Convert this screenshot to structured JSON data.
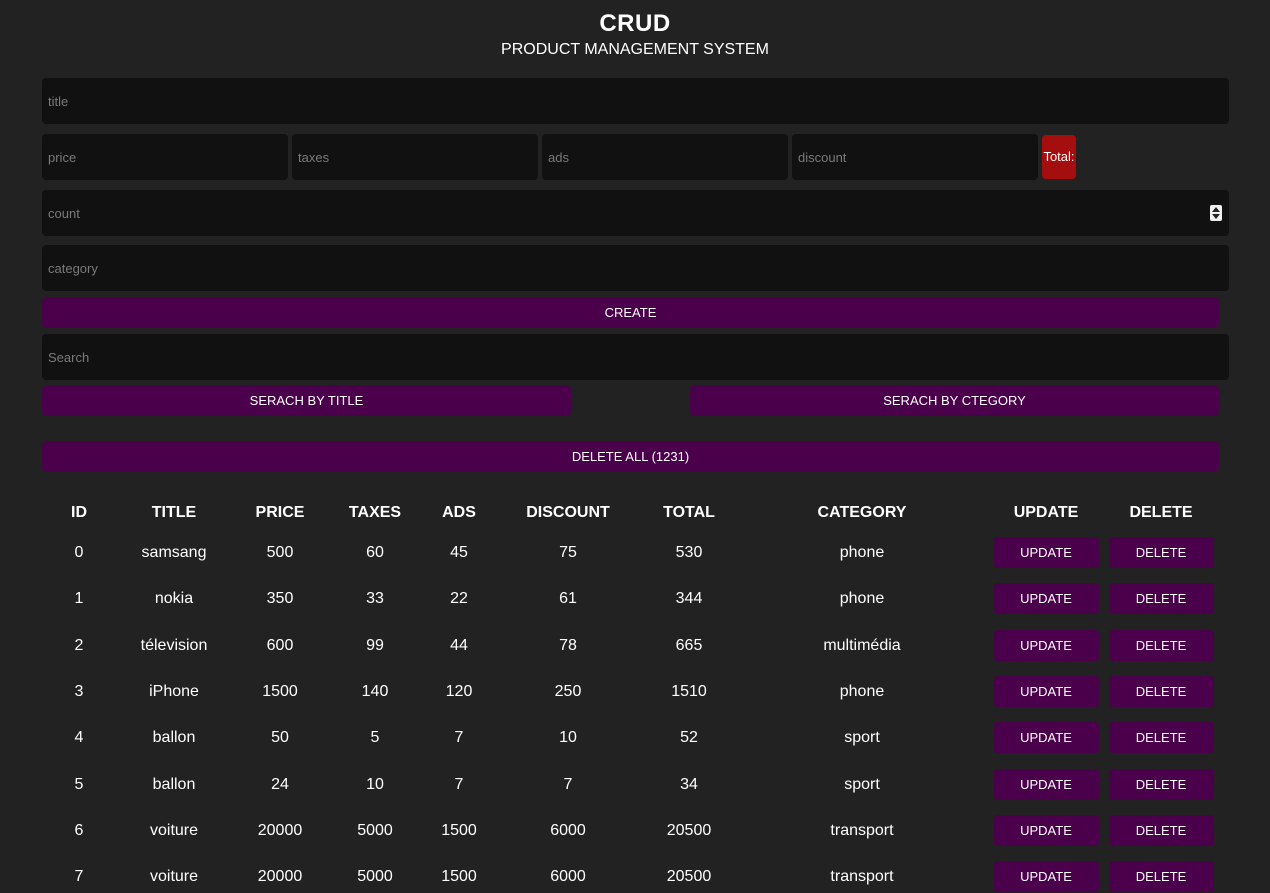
{
  "header": {
    "title": "CRUD",
    "subtitle": "PRODUCT MANAGEMENT SYSTEM"
  },
  "form": {
    "title_placeholder": "title",
    "price_placeholder": "price",
    "taxes_placeholder": "taxes",
    "ads_placeholder": "ads",
    "discount_placeholder": "discount",
    "total_label": "Total:",
    "count_placeholder": "count",
    "category_placeholder": "category",
    "create_label": "CREATE"
  },
  "search": {
    "placeholder": "Search",
    "by_title_label": "SERACH BY TITLE",
    "by_category_label": "SERACH BY CTEGORY"
  },
  "delete_all_label": "DELETE ALL (1231)",
  "table": {
    "headers": [
      "ID",
      "TITLE",
      "PRICE",
      "TAXES",
      "ADS",
      "DISCOUNT",
      "TOTAL",
      "CATEGORY",
      "UPDATE",
      "DELETE"
    ],
    "update_label": "UPDATE",
    "delete_label": "DELETE",
    "rows": [
      [
        "0",
        "samsang",
        "500",
        "60",
        "45",
        "75",
        "530",
        "phone"
      ],
      [
        "1",
        "nokia",
        "350",
        "33",
        "22",
        "61",
        "344",
        "phone"
      ],
      [
        "2",
        "télevision",
        "600",
        "99",
        "44",
        "78",
        "665",
        "multimédia"
      ],
      [
        "3",
        "iPhone",
        "1500",
        "140",
        "120",
        "250",
        "1510",
        "phone"
      ],
      [
        "4",
        "ballon",
        "50",
        "5",
        "7",
        "10",
        "52",
        "sport"
      ],
      [
        "5",
        "ballon",
        "24",
        "10",
        "7",
        "7",
        "34",
        "sport"
      ],
      [
        "6",
        "voiture",
        "20000",
        "5000",
        "1500",
        "6000",
        "20500",
        "transport"
      ],
      [
        "7",
        "voiture",
        "20000",
        "5000",
        "1500",
        "6000",
        "20500",
        "transport"
      ]
    ]
  },
  "colors": {
    "background": "#222222",
    "input_background": "#111111",
    "button_purple": "#4a004a",
    "total_red": "#a50e0e"
  }
}
